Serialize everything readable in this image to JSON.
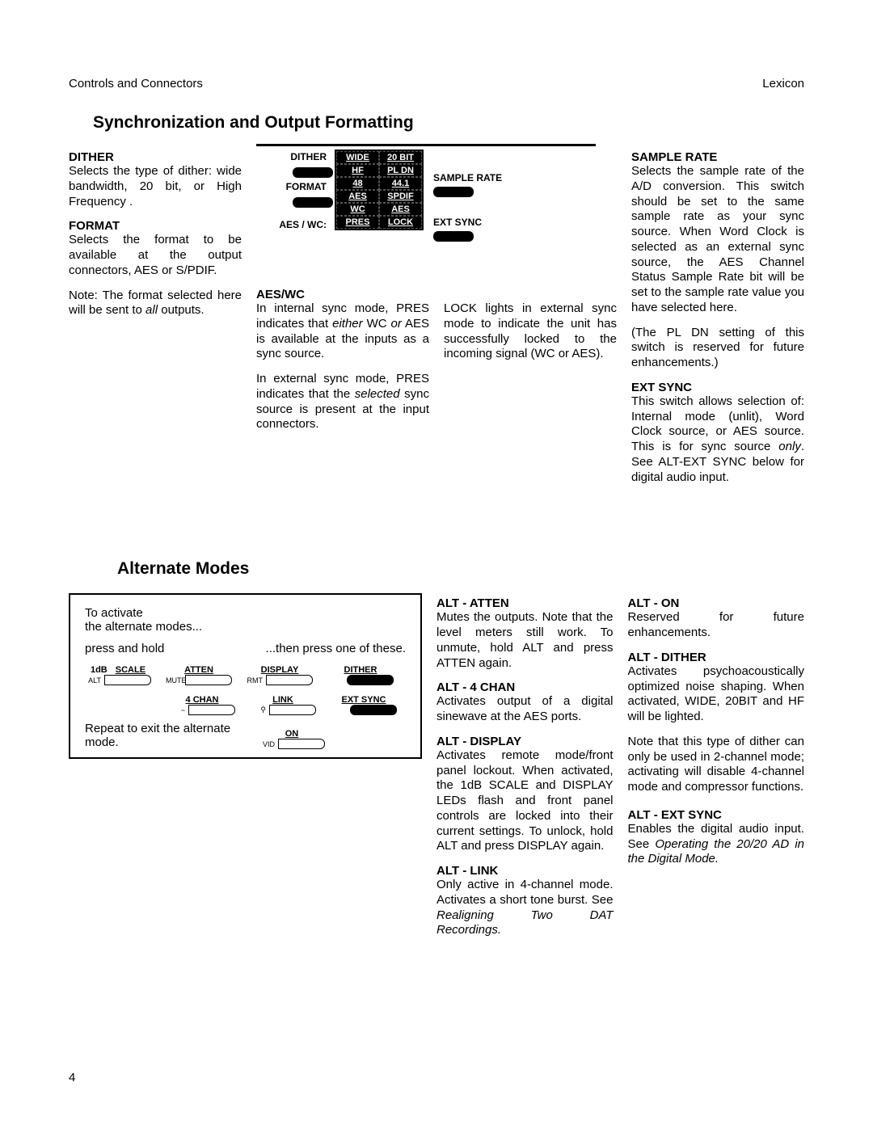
{
  "header": {
    "left": "Controls and Connectors",
    "right": "Lexicon"
  },
  "page_number": "4",
  "section1": {
    "heading": "Synchronization and Output Formatting",
    "dither": {
      "title": "DITHER",
      "body": "Selects the type of dither: wide bandwidth, 20 bit, or High Frequency ."
    },
    "format": {
      "title": "FORMAT",
      "body": "Selects the format to be available at the output connectors, AES or S/PDIF.",
      "note1": "Note: The format selected here will be sent to ",
      "note1_italic": "all",
      "note1_end": " outputs."
    },
    "diagram_labels": {
      "dither": "DITHER",
      "format": "FORMAT",
      "aeswc": "AES / WC:",
      "wide": "WIDE",
      "b20": "20 BIT",
      "hf": "HF",
      "pldn": "PL DN",
      "r48": "48",
      "r441": "44.1",
      "aes": "AES",
      "spdif": "SPDIF",
      "wc": "WC",
      "aes2": "AES",
      "pres": "PRES",
      "lock": "LOCK",
      "sample_rate": "SAMPLE RATE",
      "ext_sync": "EXT SYNC"
    },
    "aes_wc": {
      "title": "AES/WC",
      "p1a": "In internal sync mode, PRES indicates that ",
      "p1_italic1": "either",
      "p1b": " WC ",
      "p1_italic2": "or",
      "p1c": " AES is available at the inputs as a sync source.",
      "p2a": "In external sync mode, PRES indicates that the ",
      "p2_italic": "selected",
      "p2b": " sync source is present at the input connectors."
    },
    "lock": {
      "body": "LOCK lights in external sync mode to indicate the unit has successfully locked to the incoming signal (WC or AES)."
    },
    "sample_rate": {
      "title": "SAMPLE RATE",
      "p1": "Selects the sample rate of the A/D conversion. This switch should be set to the same sample rate as your sync source. When Word Clock is selected as an external sync source, the AES Channel Status Sample Rate bit will be set to the sample rate value you have selected here.",
      "p2": "(The PL DN setting of this switch is reserved for future enhancements.)"
    },
    "ext_sync": {
      "title": "EXT SYNC",
      "p1a": "This switch allows selection of: Internal mode (unlit), Word Clock source, or AES source. This is for sync source ",
      "p1_italic": "only",
      "p1b": ". See ALT-EXT SYNC below for digital audio input."
    }
  },
  "section2": {
    "heading": "Alternate Modes",
    "diagram": {
      "line1": "To activate",
      "line2": "the alternate modes...",
      "press_hold": "press and hold",
      "then_press": "...then press one of these.",
      "repeat": "Repeat to exit the alternate mode.",
      "labels": {
        "scale_1db": "1dB",
        "scale": "SCALE",
        "alt": "ALT",
        "atten": "ATTEN",
        "mute": "MUTE",
        "display": "DISPLAY",
        "rmt": "RMT",
        "dither": "DITHER",
        "chan4": "4  CHAN",
        "tilde": "~",
        "link": "LINK",
        "unlock": "⚲",
        "ext_sync": "EXT SYNC",
        "on": "ON",
        "vid": "VID"
      }
    },
    "alt_atten": {
      "title": "ALT - ATTEN",
      "body": "Mutes the outputs. Note that the level meters still work. To unmute, hold ALT and press ATTEN again."
    },
    "alt_4chan": {
      "title": "ALT - 4 CHAN",
      "body": "Activates output of a digital sinewave at the AES ports."
    },
    "alt_display": {
      "title": "ALT - DISPLAY",
      "body": "Activates remote mode/front panel lockout. When activated, the 1dB SCALE and DISPLAY LEDs flash and front panel controls are locked into their current settings. To unlock, hold ALT and press DISPLAY again."
    },
    "alt_link": {
      "title": "ALT - LINK",
      "body_a": "Only active in 4-channel mode. Activates a short tone burst. See ",
      "body_italic": "Realigning Two DAT Recordings."
    },
    "alt_on": {
      "title": "ALT - ON",
      "body": "Reserved for future enhancements."
    },
    "alt_dither": {
      "title": "ALT - DITHER",
      "p1": "Activates psychoacoustically optimized noise shaping. When activated, WIDE, 20BIT and HF will be lighted.",
      "p2": "Note that this type of dither can only be used in 2-channel mode; activating will disable 4-channel mode and compressor functions."
    },
    "alt_ext_sync": {
      "title": "ALT - EXT SYNC",
      "body_a": "Enables the digital audio input. See ",
      "body_italic": "Operating the 20/20 AD in the Digital Mode."
    }
  }
}
